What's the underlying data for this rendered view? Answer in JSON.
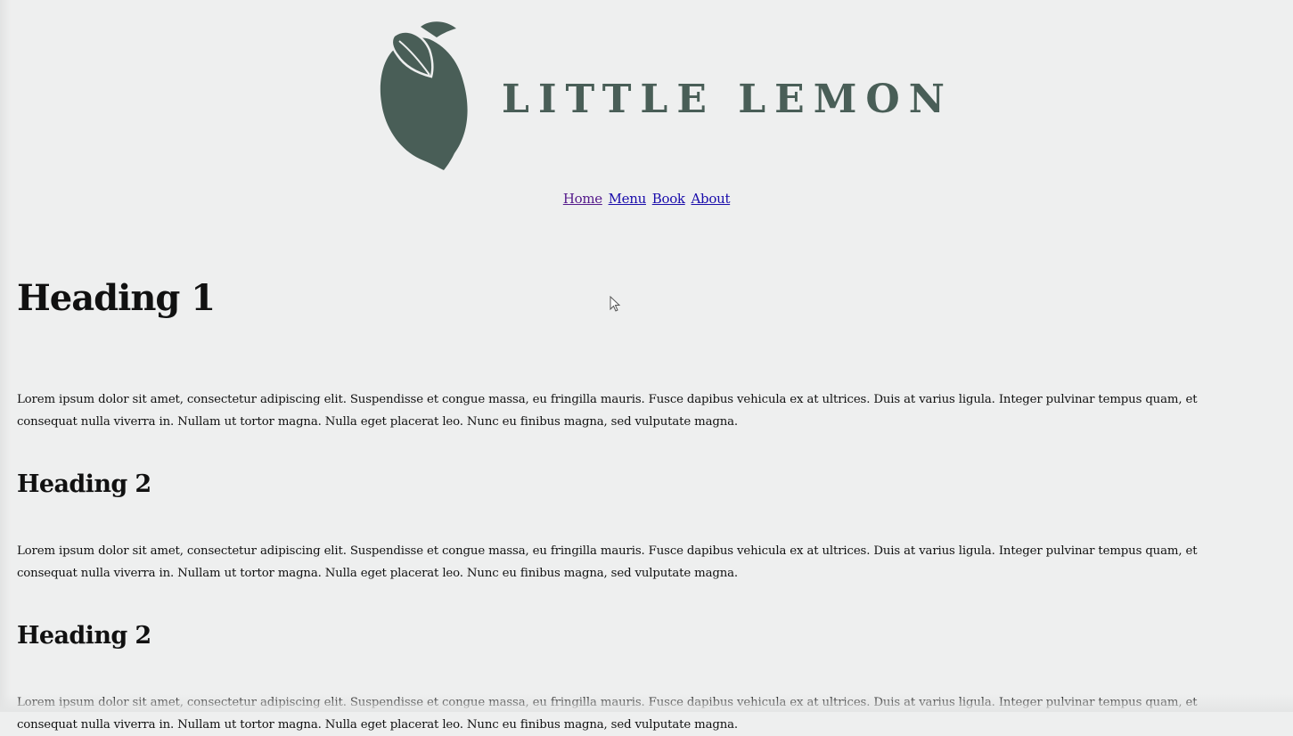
{
  "header": {
    "brand_name": "LITTLE LEMON",
    "logo_icon": "lemon-icon",
    "brand_color": "#495e57"
  },
  "nav": {
    "items": [
      {
        "label": "Home"
      },
      {
        "label": "Menu"
      },
      {
        "label": "Book"
      },
      {
        "label": "About"
      }
    ]
  },
  "main": {
    "heading1": "Heading 1",
    "sections": [
      {
        "paragraph": "Lorem ipsum dolor sit amet, consectetur adipiscing elit. Suspendisse et congue massa, eu fringilla mauris. Fusce dapibus vehicula ex at ultrices. Duis at varius ligula. Integer pulvinar tempus quam, et consequat nulla viverra in. Nullam ut tortor magna. Nulla eget placerat leo. Nunc eu finibus magna, sed vulputate magna."
      },
      {
        "heading": "Heading 2",
        "paragraph": "Lorem ipsum dolor sit amet, consectetur adipiscing elit. Suspendisse et congue massa, eu fringilla mauris. Fusce dapibus vehicula ex at ultrices. Duis at varius ligula. Integer pulvinar tempus quam, et consequat nulla viverra in. Nullam ut tortor magna. Nulla eget placerat leo. Nunc eu finibus magna, sed vulputate magna."
      },
      {
        "heading": "Heading 2",
        "paragraph": "Lorem ipsum dolor sit amet, consectetur adipiscing elit. Suspendisse et congue massa, eu fringilla mauris. Fusce dapibus vehicula ex at ultrices. Duis at varius ligula. Integer pulvinar tempus quam, et consequat nulla viverra in. Nullam ut tortor magna. Nulla eget placerat leo. Nunc eu finibus magna, sed vulputate magna."
      }
    ]
  }
}
